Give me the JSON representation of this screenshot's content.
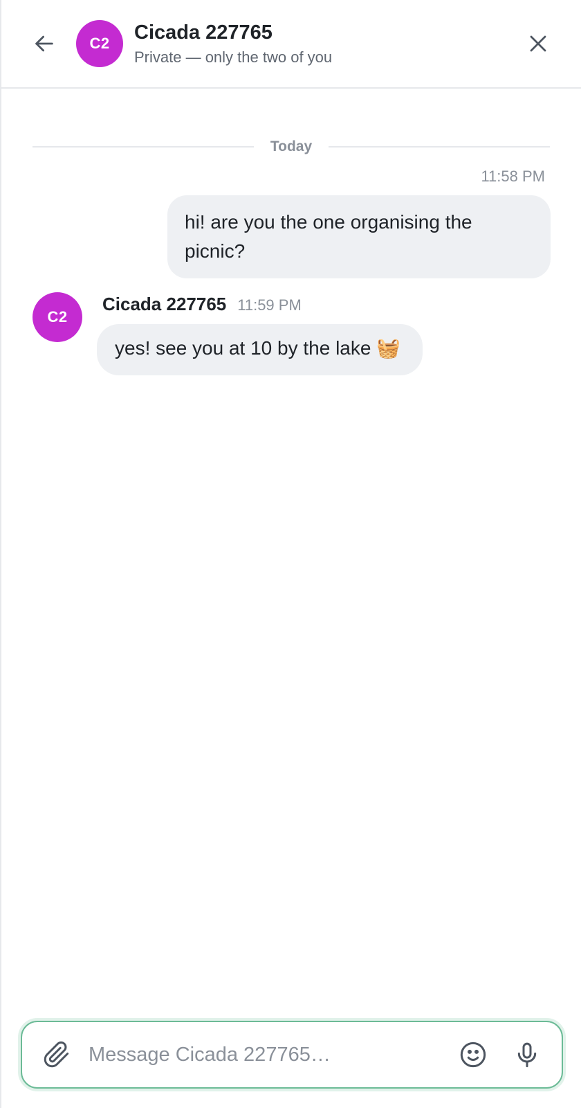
{
  "header": {
    "back_icon": "arrow-left-icon",
    "avatar_initials": "C2",
    "avatar_color": "#c42bd1",
    "title": "Cicada 227765",
    "subtitle": "Private — only the two of you",
    "close_icon": "close-icon"
  },
  "conversation": {
    "date_divider": "Today",
    "messages": [
      {
        "direction": "sent",
        "time": "11:58 PM",
        "text": "hi! are you the one organising the picnic?"
      },
      {
        "direction": "received",
        "sender_initials": "C2",
        "sender_name": "Cicada 227765",
        "time": "11:59 PM",
        "text": "yes! see you at 10 by the lake 🧺"
      }
    ]
  },
  "composer": {
    "attach_icon": "paperclip-icon",
    "placeholder": "Message Cicada 227765…",
    "value": "",
    "emoji_icon": "smiley-icon",
    "mic_icon": "microphone-icon",
    "accent_color": "#6cbb97"
  }
}
